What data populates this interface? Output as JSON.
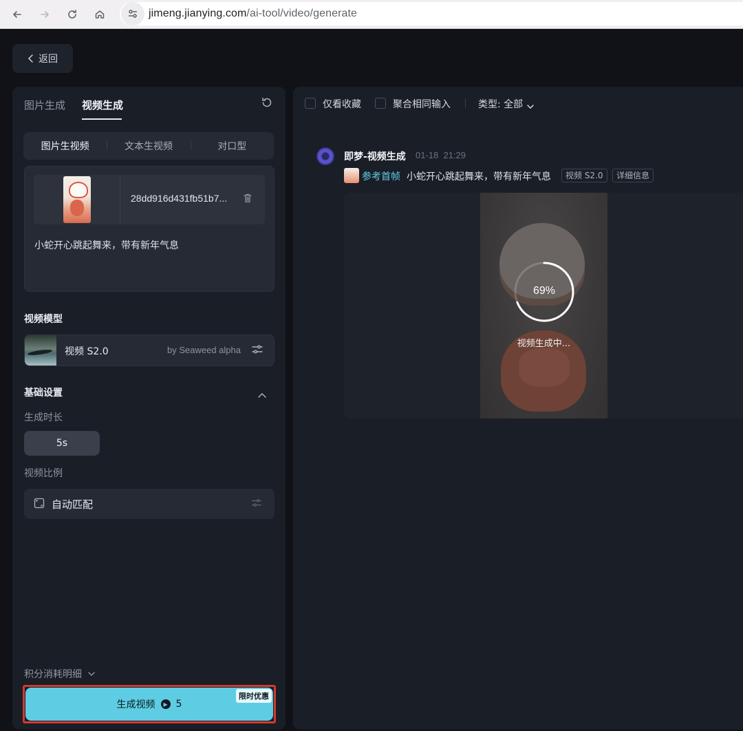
{
  "browser": {
    "url_host": "jimeng.jianying.com",
    "url_path": "/ai-tool/video/generate"
  },
  "back": {
    "label": "返回"
  },
  "left_tabs": [
    {
      "label": "图片生成",
      "active": false
    },
    {
      "label": "视频生成",
      "active": true
    }
  ],
  "modes": [
    {
      "label": "图片生视频",
      "active": true
    },
    {
      "label": "文本生视频",
      "active": false
    },
    {
      "label": "对口型",
      "active": false
    }
  ],
  "input": {
    "file_name": "28dd916d431fb51b7...",
    "prompt": "小蛇开心跳起舞来，带有新年气息"
  },
  "model": {
    "section_label": "视频模型",
    "name": "视频 S2.0",
    "by": "by Seaweed alpha"
  },
  "basic_settings": {
    "section_label": "基础设置",
    "duration_label": "生成时长",
    "duration_value": "5s",
    "ratio_label": "视频比例",
    "ratio_value": "自动匹配"
  },
  "footer": {
    "points_detail": "积分消耗明细",
    "generate_label": "生成视频",
    "cost": "5",
    "promo": "限时优惠"
  },
  "filters": {
    "favorites_only": "仅看收藏",
    "merge_same_input": "聚合相同输入",
    "type_label": "类型: 全部"
  },
  "generation": {
    "title": "即梦-视频生成",
    "date": "01-18",
    "time": "21:29",
    "ref_label": "参考首帧",
    "prompt": "小蛇开心跳起舞来，带有新年气息",
    "tags": [
      "视频 S2.0",
      "详细信息"
    ],
    "progress": 69,
    "progress_text": "69%",
    "status": "视频生成中..."
  },
  "colors": {
    "accent": "#5ecde3",
    "highlight_outline": "#d23a2e",
    "panel_bg": "#1a1e26"
  }
}
